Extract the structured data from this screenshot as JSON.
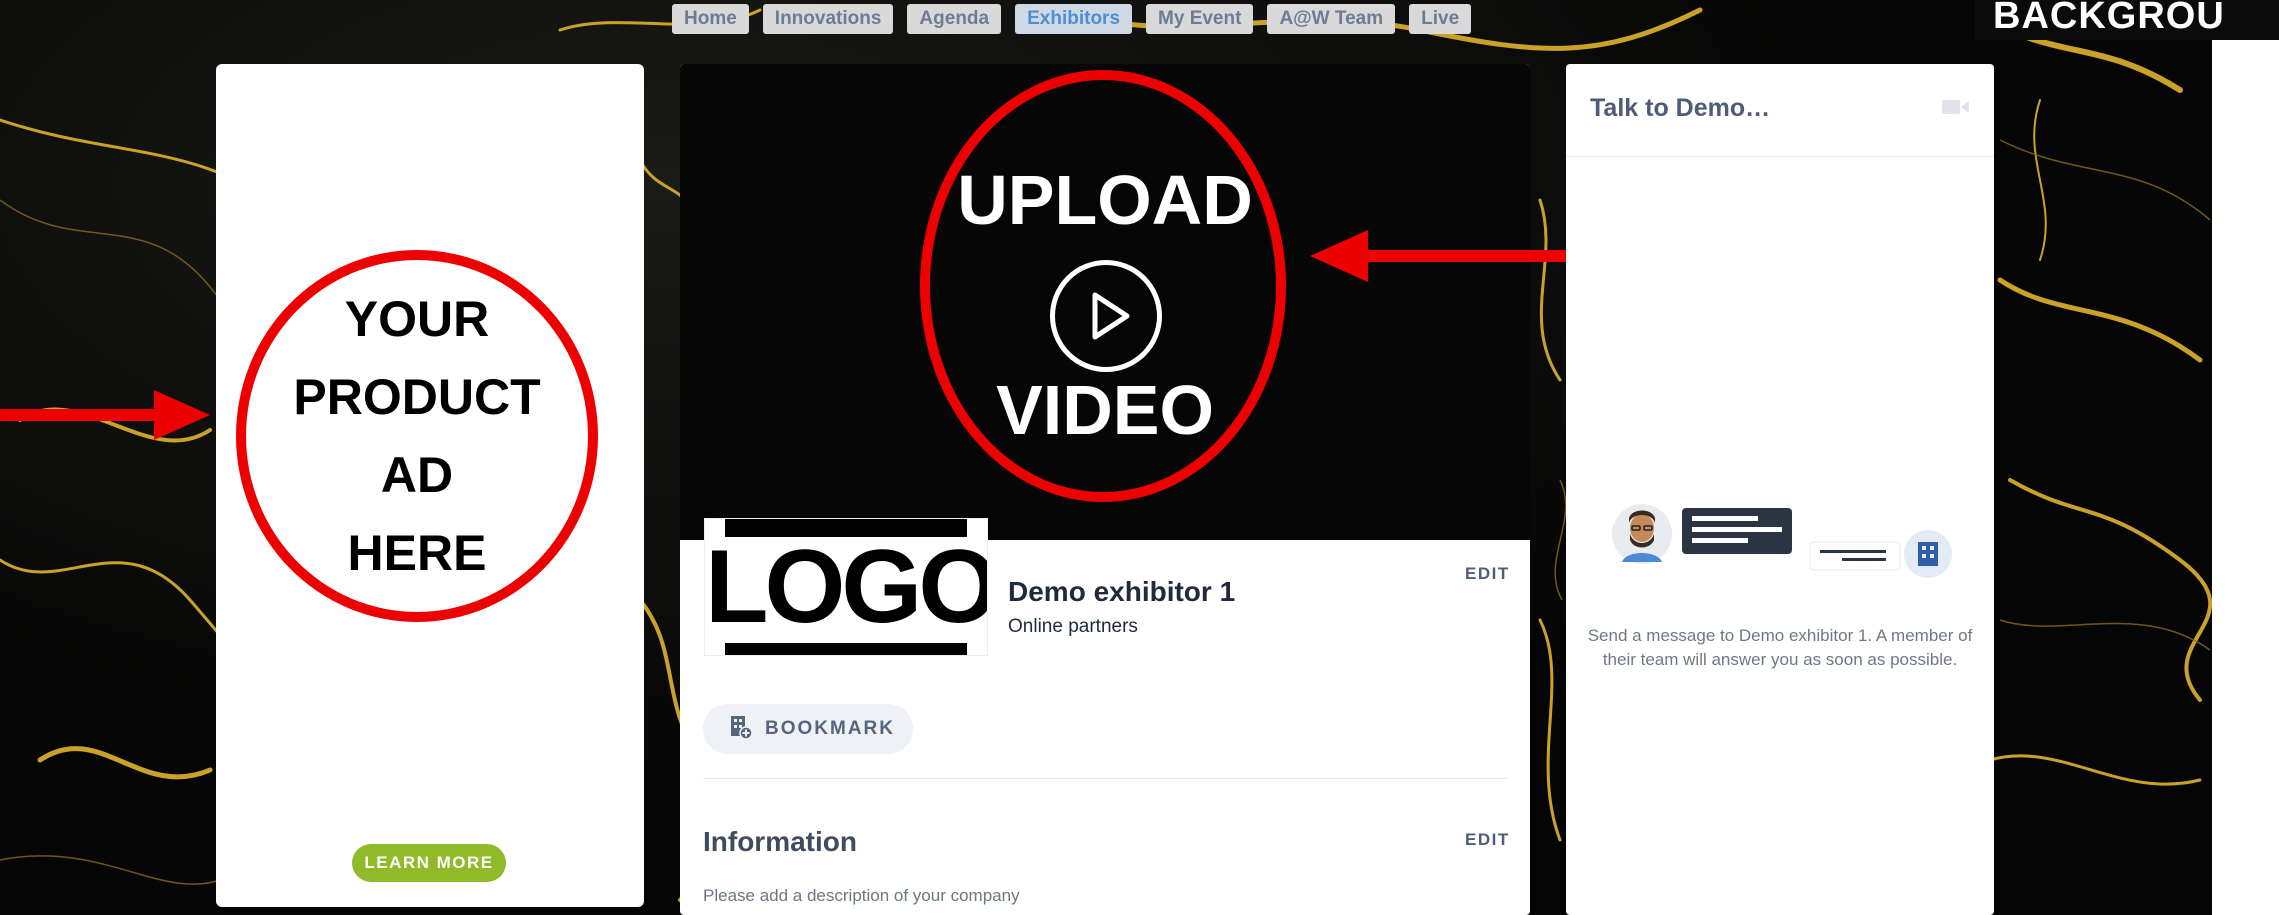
{
  "background_label": "BACKGROU",
  "nav": {
    "items": [
      {
        "label": "Home"
      },
      {
        "label": "Innovations"
      },
      {
        "label": "Agenda"
      },
      {
        "label": "Exhibitors",
        "active": true
      },
      {
        "label": "My Event"
      },
      {
        "label": "A@W Team"
      },
      {
        "label": "Live"
      }
    ]
  },
  "ad": {
    "lines": [
      "YOUR",
      "PRODUCT",
      "AD",
      "HERE"
    ],
    "learn_more": "LEARN MORE"
  },
  "video": {
    "upload_label": "UPLOAD",
    "video_label": "VIDEO",
    "play_icon": "play-icon"
  },
  "exhibitor": {
    "logo_text": "LOGO",
    "name": "Demo exhibitor 1",
    "category": "Online partners",
    "edit_label": "EDIT",
    "bookmark_label": "BOOKMARK"
  },
  "information": {
    "title": "Information",
    "edit_label": "EDIT",
    "description": "Please add a description of your company"
  },
  "chat": {
    "title": "Talk to Demo…",
    "message": "Send a message to Demo exhibitor 1. A member of their team will answer you as soon as possible."
  },
  "colors": {
    "annotation_red": "#e00000",
    "learn_more_green": "#8fba2a",
    "nav_active": "#4d8fd1"
  }
}
